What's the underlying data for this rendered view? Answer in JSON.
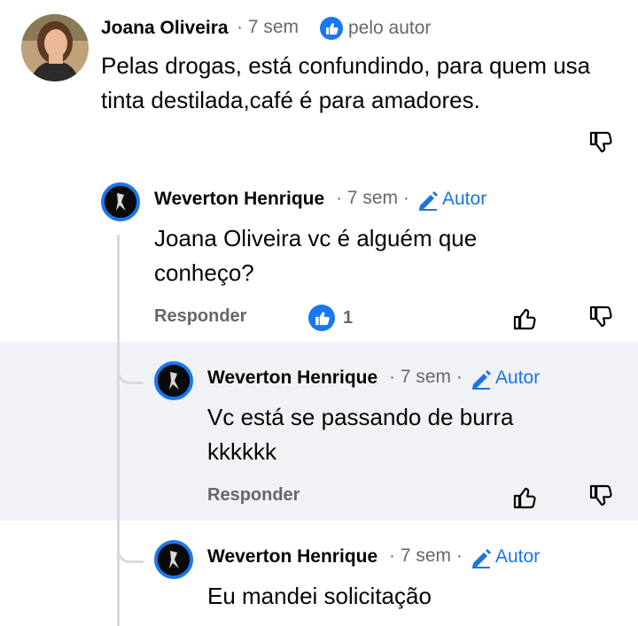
{
  "comments": [
    {
      "author": "Joana Oliveira",
      "time": "· 7 sem",
      "reaction_label": "pelo autor",
      "text": "Pelas drogas, está confundindo, para quem usa  tinta destilada,café é para amadores."
    },
    {
      "author": "Weverton Henrique",
      "time": "· 7 sem ·",
      "badge": "Autor",
      "text": "Joana Oliveira vc é alguém que conheço?",
      "reply_label": "Responder",
      "like_count": "1"
    },
    {
      "author": "Weverton Henrique",
      "time": "· 7 sem ·",
      "badge": "Autor",
      "text": "Vc está se passando de burra kkkkkk",
      "reply_label": "Responder"
    },
    {
      "author": "Weverton Henrique",
      "time": "· 7 sem ·",
      "badge": "Autor",
      "text": "Eu mandei solicitação"
    }
  ],
  "colors": {
    "accent": "#1877f2",
    "highlight_bg": "#f0f2f5",
    "secondary_text": "#65676b"
  }
}
